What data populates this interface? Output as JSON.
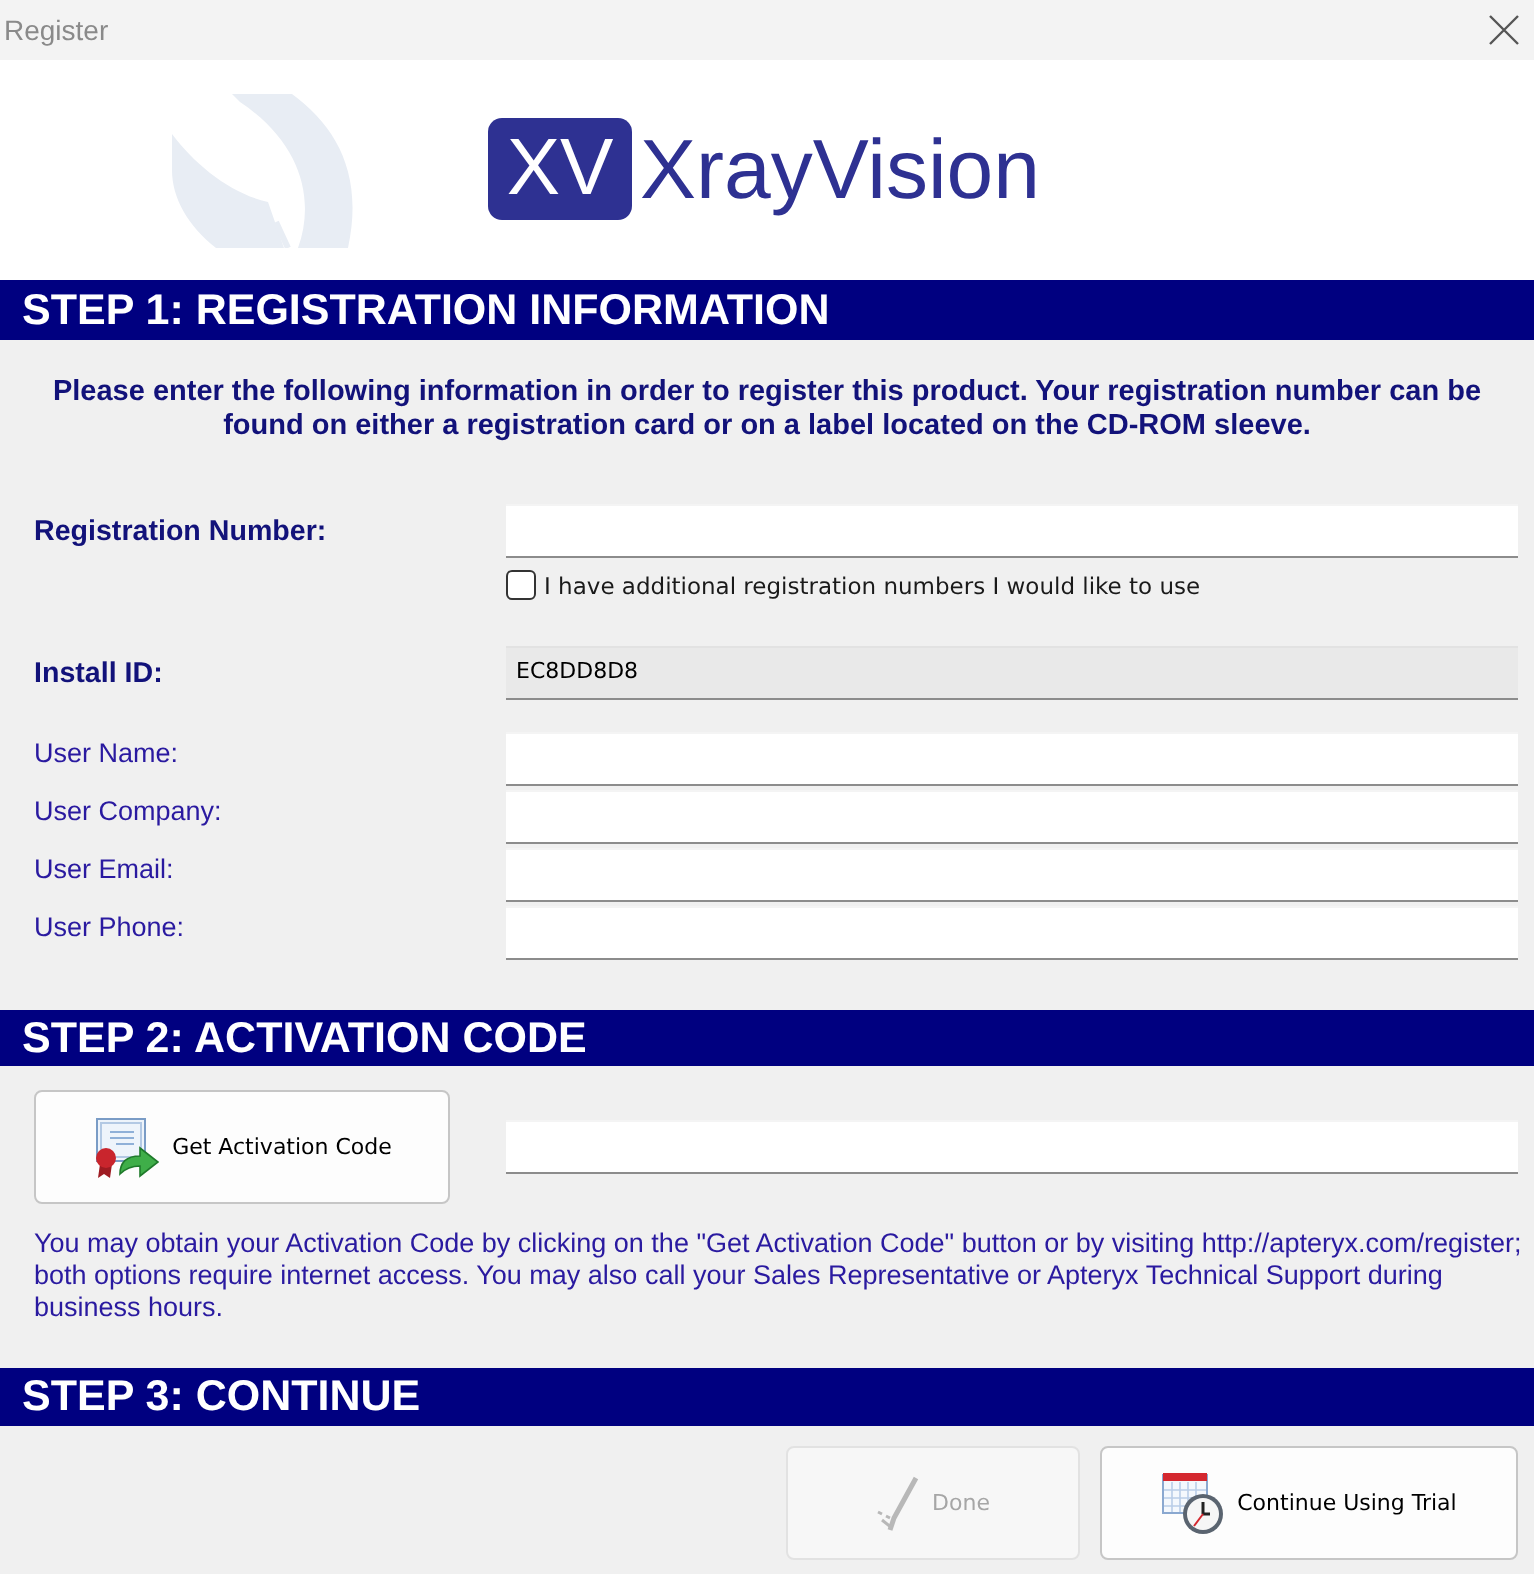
{
  "window": {
    "title": "Register"
  },
  "logo": {
    "badge": "XV",
    "name": "XrayVision"
  },
  "step1": {
    "heading": "STEP 1: REGISTRATION INFORMATION",
    "instructions": "Please enter the following information in order to register this product. Your registration number can be found on either a registration card or on a label located on the CD-ROM sleeve.",
    "registration_number": {
      "label": "Registration Number:"
    },
    "additional_numbers": {
      "label": "I have additional registration numbers I would like to use",
      "checked": false
    },
    "install_id": {
      "label": "Install ID:",
      "value": "EC8DD8D8",
      "read_only": true
    },
    "user_fields": [
      {
        "label": "User Name:"
      },
      {
        "label": "User Company:"
      },
      {
        "label": "User Email:"
      },
      {
        "label": "User Phone:"
      }
    ]
  },
  "step2": {
    "heading": "STEP 2: ACTIVATION CODE",
    "button": {
      "label": "Get Activation Code"
    },
    "note": "You may obtain your Activation Code by clicking on the \"Get Activation Code\" button or by visiting http://apteryx.com/register; both options require internet access. You may also call your Sales Representative or Apteryx Technical Support during business hours."
  },
  "step3": {
    "heading": "STEP 3: CONTINUE",
    "buttons": [
      {
        "label": "Done",
        "kind": "check",
        "disabled": true
      },
      {
        "label": "Continue Using Trial",
        "kind": "trial",
        "disabled": false
      }
    ]
  }
}
